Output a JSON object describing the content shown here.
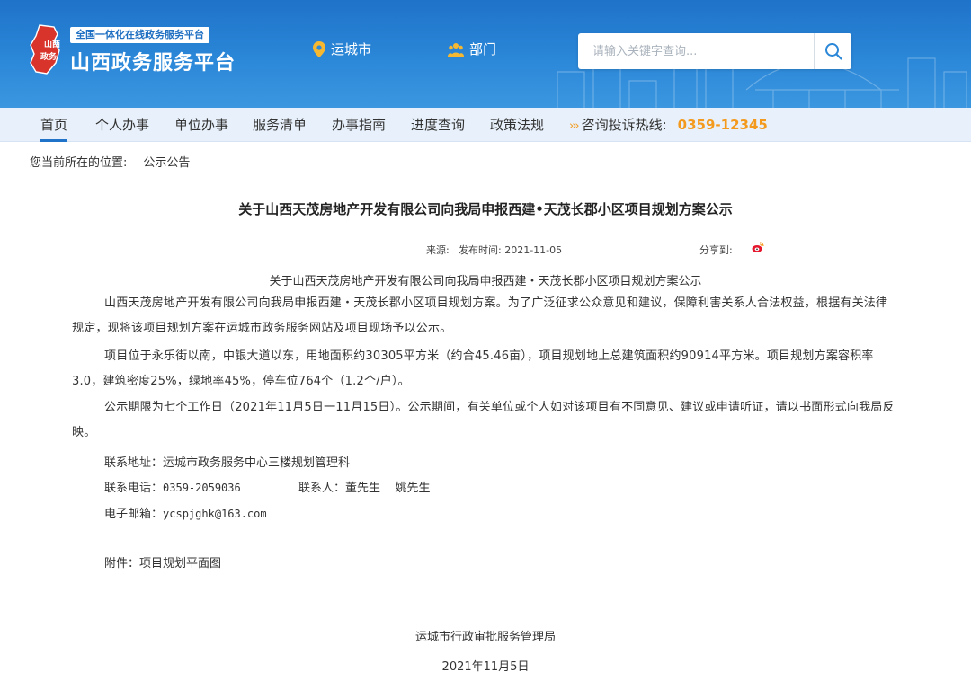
{
  "header": {
    "slogan": "全国一体化在线政务服务平台",
    "platform_name": "山西政务服务平台",
    "logo_text": "山西政务",
    "location_city": "运城市",
    "location_dept": "部门",
    "search_placeholder": "请输入关键字查询...",
    "colors": {
      "header_bg": "#2b87d8",
      "accent": "#f39a1e",
      "nav_bg": "#e8f1fb"
    }
  },
  "nav": {
    "items": [
      "首页",
      "个人办事",
      "单位办事",
      "服务清单",
      "办事指南",
      "进度查询",
      "政策法规"
    ],
    "active_index": 0,
    "hotline_arrows": "›››",
    "hotline_label": "咨询投诉热线:",
    "hotline_number": "0359-12345"
  },
  "breadcrumb": {
    "label": "您当前所在的位置:",
    "current": "公示公告"
  },
  "article": {
    "title": "关于山西天茂房地产开发有限公司向我局申报西建•天茂长郡小区项目规划方案公示",
    "source_label": "来源:",
    "date_label": "发布时间: 2021-11-05",
    "share_label": "分享到:",
    "subtitle": "关于山西天茂房地产开发有限公司向我局申报西建・天茂长郡小区项目规划方案公示",
    "paragraphs": [
      "山西天茂房地产开发有限公司向我局申报西建・天茂长郡小区项目规划方案。为了广泛征求公众意见和建议，保障利害关系人合法权益，根据有关法律规定，现将该项目规划方案在运城市政务服务网站及项目现场予以公示。",
      "项目位于永乐街以南，中银大道以东，用地面积约30305平方米（约合45.46亩），项目规划地上总建筑面积约90914平方米。项目规划方案容积率3.0，建筑密度25%，绿地率45%，停车位764个（1.2个/户）。",
      "公示期限为七个工作日（2021年11月5日一11月15日）。公示期间，有关单位或个人如对该项目有不同意见、建议或申请听证，请以书面形式向我局反映。"
    ],
    "contact_address": "联系地址：运城市政务服务中心三楼规划管理科",
    "contact_phone_label": "联系电话：",
    "contact_phone": "0359-2059036",
    "contact_person": "联系人：董先生    姚先生",
    "email_label": "电子邮箱：",
    "email": "ycspjghk@163.com",
    "attachment": "附件：项目规划平面图",
    "signature": "运城市行政审批服务管理局",
    "sign_date": "2021年11月5日"
  }
}
